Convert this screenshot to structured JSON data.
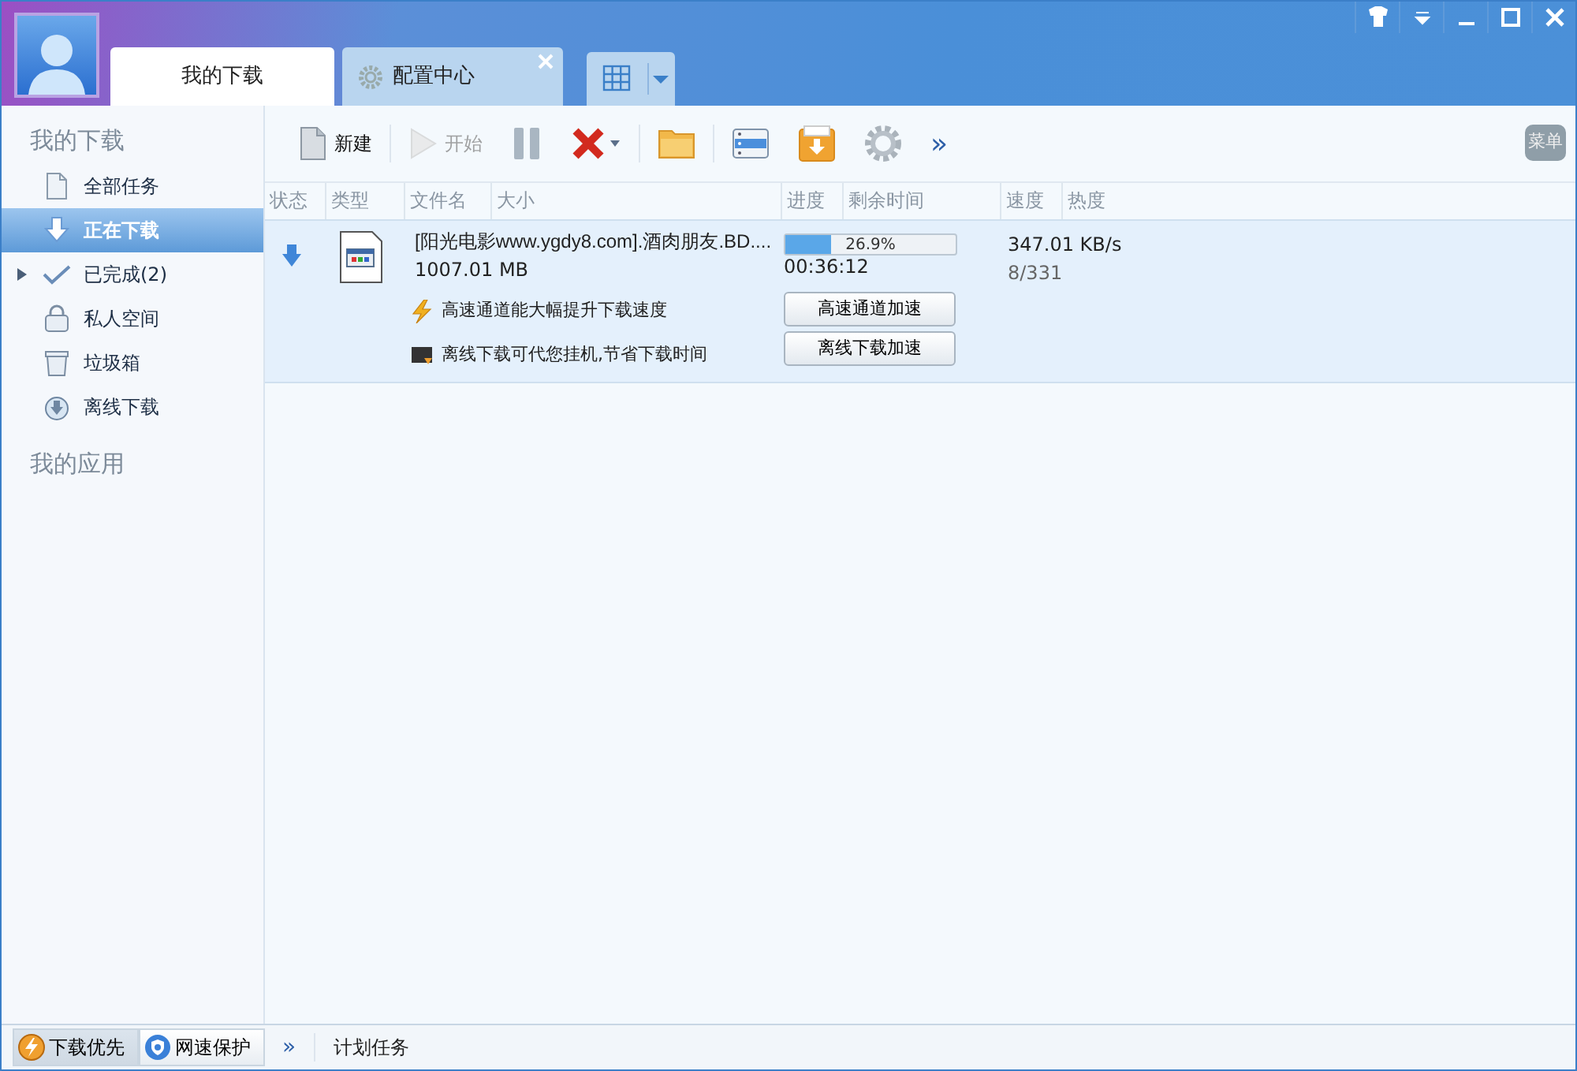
{
  "tabs": [
    {
      "label": "我的下载",
      "selected": true,
      "kind": "plain",
      "closable": false
    },
    {
      "label": "配置中心",
      "selected": false,
      "kind": "settings",
      "closable": true
    }
  ],
  "sidebar": {
    "sections": [
      {
        "title": "我的下载",
        "items": [
          {
            "label": "全部任务",
            "kind": "document",
            "selected": false,
            "expandable": false
          },
          {
            "label": "正在下载",
            "kind": "download",
            "selected": true,
            "expandable": false
          },
          {
            "label": "已完成(2)",
            "kind": "check",
            "selected": false,
            "expandable": true
          },
          {
            "label": "私人空间",
            "kind": "lock",
            "selected": false,
            "expandable": false
          },
          {
            "label": "垃圾箱",
            "kind": "trash",
            "selected": false,
            "expandable": false
          },
          {
            "label": "离线下载",
            "kind": "cloud",
            "selected": false,
            "expandable": false
          }
        ]
      },
      {
        "title": "我的应用"
      }
    ]
  },
  "toolbar": {
    "buttons": [
      {
        "kind": "new",
        "label": "新建",
        "disabled": false
      },
      {
        "kind": "start",
        "label": "开始",
        "disabled": true
      },
      {
        "kind": "pause",
        "disabled": false
      },
      {
        "kind": "delete",
        "disabled": false
      },
      {
        "kind": "folder",
        "disabled": false
      },
      {
        "kind": "list",
        "disabled": false
      },
      {
        "kind": "download-box",
        "disabled": false
      },
      {
        "kind": "gear",
        "disabled": false
      },
      {
        "kind": "more",
        "label": "»"
      }
    ],
    "menu_button": "菜单"
  },
  "table": {
    "columns": [
      "状态",
      "类型",
      "文件名",
      "大小",
      "进度",
      "剩余时间",
      "速度",
      "热度"
    ],
    "rows": [
      {
        "selected": true,
        "name": "[阳光电影www.ygdy8.com].酒肉朋友.BD....",
        "size": "1007.01 MB",
        "level": 0.269,
        "percent": "26.9%",
        "remaining": "00:36:12",
        "speed": "347.01 KB/s",
        "peers": "8/331",
        "tips": [
          {
            "kind": "bolt",
            "text": "高速通道能大幅提升下载速度",
            "button": "高速通道加速"
          },
          {
            "kind": "monitor",
            "text": "离线下载可代您挂机,节省下载时间",
            "button": "离线下载加速"
          }
        ]
      }
    ]
  },
  "status_bar": {
    "toggles": [
      {
        "kind": "bolt",
        "label": "下载优先",
        "selected": true
      },
      {
        "kind": "shield",
        "label": "网速保护",
        "selected": false
      }
    ],
    "more": "»",
    "task": "计划任务"
  }
}
